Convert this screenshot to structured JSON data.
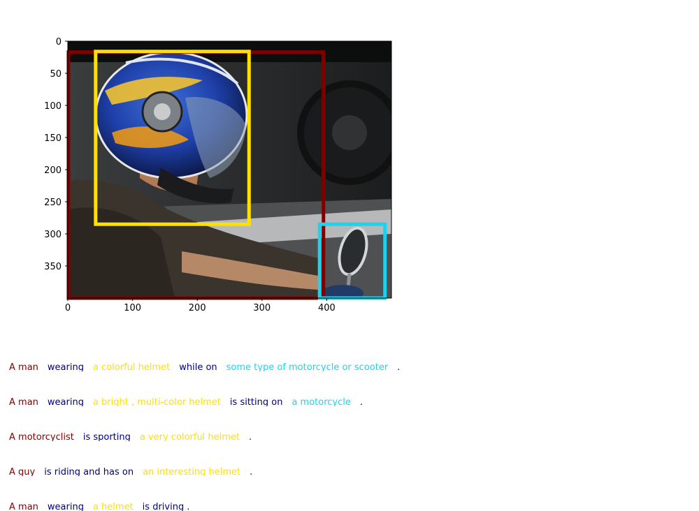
{
  "palette": {
    "person": "#800000",
    "helmet": "#ffe000",
    "vehicle": "#1cd2ef",
    "verb": "#000080",
    "punct": "#000080"
  },
  "axes": {
    "x_ticks": [
      "0",
      "100",
      "200",
      "300",
      "400"
    ],
    "y_ticks": [
      "0",
      "50",
      "100",
      "150",
      "200",
      "250",
      "300",
      "350"
    ]
  },
  "scene": {
    "image_width": 500,
    "image_height": 400,
    "boxes": [
      {
        "label": "person",
        "color": "#800000",
        "x0": 1,
        "y0": 17,
        "x1": 395,
        "y1": 400
      },
      {
        "label": "helmet",
        "color": "#ffe000",
        "x0": 43,
        "y0": 16,
        "x1": 280,
        "y1": 285
      },
      {
        "label": "vehicle",
        "color": "#1cd2ef",
        "x0": 389,
        "y0": 285,
        "x1": 490,
        "y1": 400
      }
    ]
  },
  "captions": [
    [
      {
        "text": "A man",
        "role": "person"
      },
      {
        "text": "wearing",
        "role": "verb"
      },
      {
        "text": "a colorful helmet",
        "role": "helmet"
      },
      {
        "text": "while on",
        "role": "verb"
      },
      {
        "text": "some type of motorcycle or scooter",
        "role": "vehicle"
      },
      {
        "text": ".",
        "role": "punct"
      }
    ],
    [
      {
        "text": "A man",
        "role": "person"
      },
      {
        "text": "wearing",
        "role": "verb"
      },
      {
        "text": "a bright , multi-color helmet",
        "role": "helmet"
      },
      {
        "text": "is sitting on",
        "role": "verb"
      },
      {
        "text": "a motorcycle",
        "role": "vehicle"
      },
      {
        "text": ".",
        "role": "punct"
      }
    ],
    [
      {
        "text": "A motorcyclist",
        "role": "person"
      },
      {
        "text": "is sporting",
        "role": "verb"
      },
      {
        "text": "a very colorful helmet",
        "role": "helmet"
      },
      {
        "text": ".",
        "role": "punct"
      }
    ],
    [
      {
        "text": "A guy",
        "role": "person"
      },
      {
        "text": "is riding and has on",
        "role": "verb"
      },
      {
        "text": "an interesting helmet",
        "role": "helmet"
      },
      {
        "text": ".",
        "role": "punct"
      }
    ],
    [
      {
        "text": "A man",
        "role": "person"
      },
      {
        "text": "wearing",
        "role": "verb"
      },
      {
        "text": "a helmet",
        "role": "helmet"
      },
      {
        "text": "is driving",
        "role": "verb",
        "tight": true
      },
      {
        "text": ".",
        "role": "punct"
      }
    ]
  ]
}
